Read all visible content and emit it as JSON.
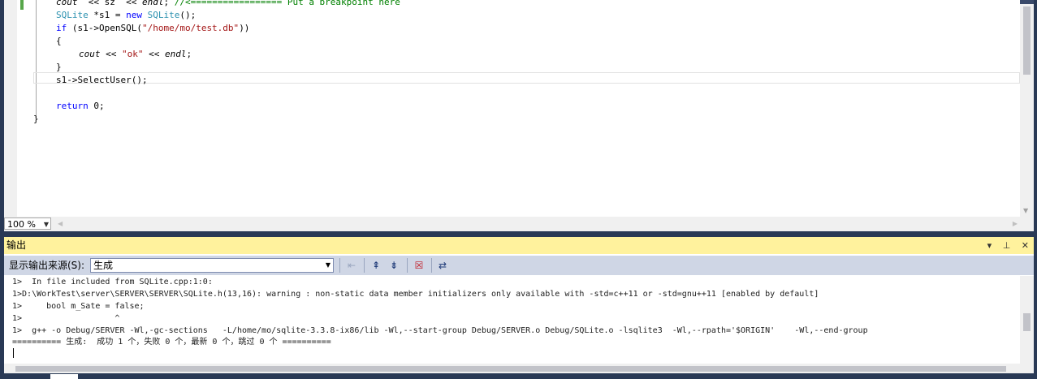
{
  "editor": {
    "code_lines": [
      {
        "indent": "    ",
        "parts": [
          [
            "it",
            "cout"
          ],
          [
            "",
            "  << "
          ],
          [
            "",
            "sz"
          ],
          [
            "",
            "  << "
          ],
          [
            "it",
            "endl"
          ],
          [
            "",
            "; "
          ],
          [
            "cm",
            "//<================= Put a breakpoint here"
          ]
        ]
      },
      {
        "indent": "    ",
        "parts": [
          [
            "ty",
            "SQLite"
          ],
          [
            "",
            " *s1 = "
          ],
          [
            "kw",
            "new"
          ],
          [
            "",
            " "
          ],
          [
            "ty",
            "SQLite"
          ],
          [
            "",
            "();"
          ]
        ]
      },
      {
        "indent": "    ",
        "parts": [
          [
            "kw",
            "if"
          ],
          [
            "",
            " (s1->OpenSQL("
          ],
          [
            "st",
            "\"/home/mo/test.db\""
          ],
          [
            "",
            "))"
          ]
        ]
      },
      {
        "indent": "    ",
        "parts": [
          [
            "",
            "{"
          ]
        ]
      },
      {
        "indent": "        ",
        "parts": [
          [
            "it",
            "cout"
          ],
          [
            "",
            " << "
          ],
          [
            "st",
            "\"ok\""
          ],
          [
            "",
            " << "
          ],
          [
            "it",
            "endl"
          ],
          [
            "",
            ";"
          ]
        ]
      },
      {
        "indent": "    ",
        "parts": [
          [
            "",
            "}"
          ]
        ]
      },
      {
        "indent": "    ",
        "parts": [
          [
            "",
            "s1->SelectUser();"
          ]
        ]
      },
      {
        "indent": "",
        "parts": [
          [
            "",
            ""
          ]
        ]
      },
      {
        "indent": "    ",
        "parts": [
          [
            "kw",
            "return"
          ],
          [
            "",
            " 0;"
          ]
        ]
      },
      {
        "indent": "",
        "parts": [
          [
            "",
            "}"
          ]
        ]
      }
    ],
    "zoom": "100 %"
  },
  "output": {
    "title": "输出",
    "pin_icons": [
      "▾",
      "📌",
      "✕"
    ],
    "source_label": "显示输出来源(S):",
    "source_value": "生成",
    "lines": [
      "1>  In file included from SQLite.cpp:1:0:",
      "1>D:\\WorkTest\\server\\SERVER\\SERVER\\SQLite.h(13,16): warning : non-static data member initializers only available with -std=c++11 or -std=gnu++11 [enabled by default]",
      "1>     bool m_Sate = false;",
      "1>                   ^",
      "1>  g++ -o Debug/SERVER -Wl,-gc-sections   -L/home/mo/sqlite-3.3.8-ix86/lib -Wl,--start-group Debug/SERVER.o Debug/SQLite.o -lsqlite3  -Wl,--rpath='$ORIGIN'    -Wl,--end-group",
      "========== 生成:  成功 1 个，失败 0 个，最新 0 个，跳过 0 个 =========="
    ]
  }
}
